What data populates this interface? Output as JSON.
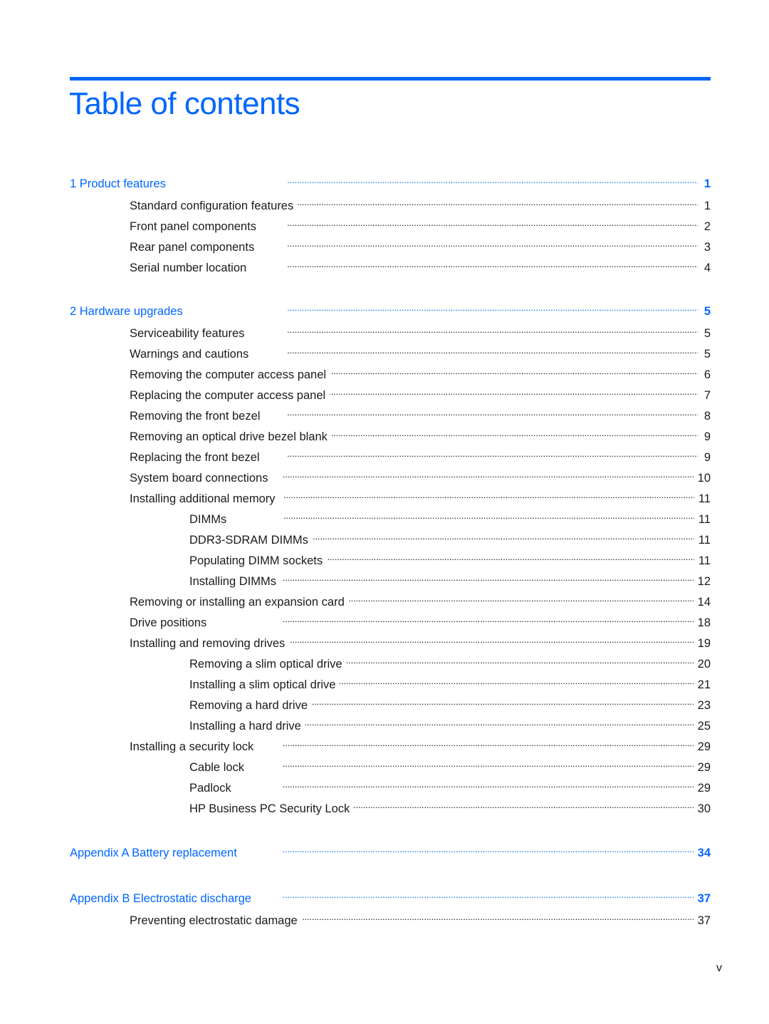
{
  "document": {
    "title": "Table of contents",
    "accent_color": "#0066ff",
    "footer_page_number": "v"
  },
  "toc": [
    {
      "level": 1,
      "type": "chapter",
      "label": "1  Product features",
      "page": "1"
    },
    {
      "level": 2,
      "label": "Standard configuration features",
      "page": "1"
    },
    {
      "level": 2,
      "label": "Front panel components",
      "page": "2"
    },
    {
      "level": 2,
      "label": "Rear panel components",
      "page": "3"
    },
    {
      "level": 2,
      "label": "Serial number location",
      "page": "4"
    },
    {
      "level": 1,
      "type": "chapter",
      "label": "2  Hardware upgrades",
      "page": "5"
    },
    {
      "level": 2,
      "label": "Serviceability features",
      "page": "5"
    },
    {
      "level": 2,
      "label": "Warnings and cautions",
      "page": "5"
    },
    {
      "level": 2,
      "label": "Removing the computer access panel",
      "page": "6"
    },
    {
      "level": 2,
      "label": "Replacing the computer access panel",
      "page": "7"
    },
    {
      "level": 2,
      "label": "Removing the front bezel",
      "page": "8"
    },
    {
      "level": 2,
      "label": "Removing an optical drive bezel blank",
      "page": "9"
    },
    {
      "level": 2,
      "label": "Replacing the front bezel",
      "page": "9"
    },
    {
      "level": 2,
      "label": "System board connections",
      "page": "10"
    },
    {
      "level": 2,
      "label": "Installing additional memory",
      "page": "11"
    },
    {
      "level": 3,
      "label": "DIMMs",
      "page": "11"
    },
    {
      "level": 3,
      "label": "DDR3-SDRAM DIMMs",
      "page": "11"
    },
    {
      "level": 3,
      "label": "Populating DIMM sockets",
      "page": "11"
    },
    {
      "level": 3,
      "label": "Installing DIMMs",
      "page": "12"
    },
    {
      "level": 2,
      "label": "Removing or installing an expansion card",
      "page": "14"
    },
    {
      "level": 2,
      "label": "Drive positions",
      "page": "18"
    },
    {
      "level": 2,
      "label": "Installing and removing drives",
      "page": "19"
    },
    {
      "level": 3,
      "label": "Removing a slim optical drive",
      "page": "20"
    },
    {
      "level": 3,
      "label": "Installing a slim optical drive",
      "page": "21"
    },
    {
      "level": 3,
      "label": "Removing a hard drive",
      "page": "23"
    },
    {
      "level": 3,
      "label": "Installing a hard drive",
      "page": "25"
    },
    {
      "level": 2,
      "label": "Installing a security lock",
      "page": "29"
    },
    {
      "level": 3,
      "label": "Cable lock",
      "page": "29"
    },
    {
      "level": 3,
      "label": "Padlock",
      "page": "29"
    },
    {
      "level": 3,
      "label": "HP Business PC Security Lock",
      "page": "30"
    },
    {
      "level": 1,
      "type": "chapter",
      "label": "Appendix A  Battery replacement",
      "page": "34"
    },
    {
      "level": 1,
      "type": "chapter",
      "label": "Appendix B  Electrostatic discharge",
      "page": "37"
    },
    {
      "level": 2,
      "label": "Preventing electrostatic damage",
      "page": "37"
    }
  ]
}
